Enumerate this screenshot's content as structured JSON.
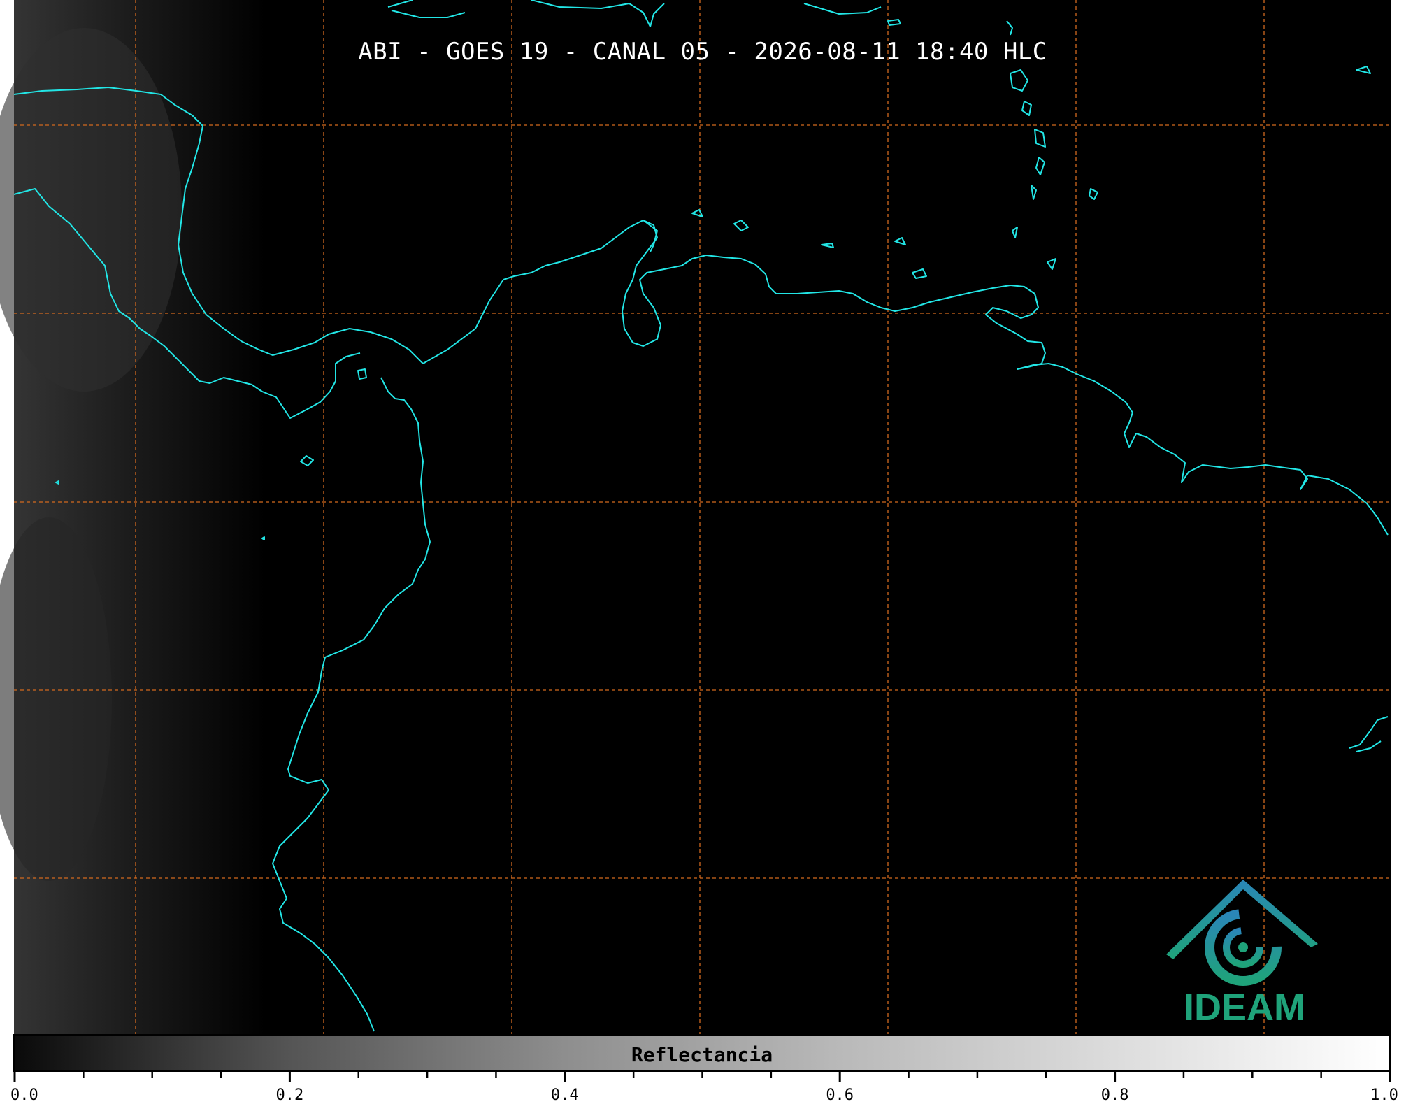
{
  "title": "ABI - GOES 19 - CANAL 05 - 2026-08-11 18:40 HLC",
  "colorbar": {
    "label": "Reflectancia",
    "range": [
      0.0,
      1.0
    ],
    "major_ticks": [
      "0.0",
      "0.2",
      "0.4",
      "0.6",
      "0.8",
      "1.0"
    ],
    "minor_tick_step": 0.05
  },
  "logo": {
    "text": "IDEAM"
  },
  "colors": {
    "background": "#000000",
    "coastline": "#22e6e6",
    "gridline": "#d2691e",
    "logo_green": "#1fa37a",
    "logo_blue": "#2a86b8"
  },
  "gridlines": {
    "style": "dashed"
  }
}
